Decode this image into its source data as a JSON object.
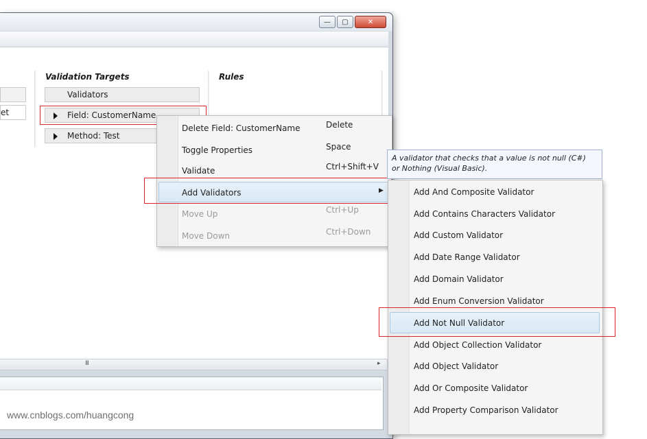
{
  "window": {
    "caption_buttons": {
      "minimize_glyph": "—",
      "maximize_glyph": "▢",
      "close_glyph": "✕"
    },
    "left_field_partial": "et",
    "scrollbar_grip": "III"
  },
  "columns": {
    "validation_targets_title": "Validation Targets",
    "rules_title": "Rules"
  },
  "targets": {
    "validators_label": "Validators",
    "field_label": "Field: CustomerName",
    "method_label": "Method: Test"
  },
  "context_menu": {
    "items": [
      {
        "label": "Delete Field: CustomerName",
        "shortcut": "Delete",
        "enabled": true
      },
      {
        "label": "Toggle Properties",
        "shortcut": "Space",
        "enabled": true
      },
      {
        "label": "Validate",
        "shortcut": "Ctrl+Shift+V",
        "enabled": true
      },
      {
        "label": "Add Validators",
        "shortcut": "",
        "enabled": true,
        "submenu_arrow": "▶"
      },
      {
        "label": "Move Up",
        "shortcut": "Ctrl+Up",
        "enabled": false
      },
      {
        "label": "Move Down",
        "shortcut": "Ctrl+Down",
        "enabled": false
      }
    ]
  },
  "tooltip": {
    "line1": "A validator that checks that a value is not null (C#)",
    "line2": "or Nothing (Visual Basic)."
  },
  "validators_submenu": {
    "items": [
      "Add And Composite Validator",
      "Add Contains Characters Validator",
      "Add Custom Validator",
      "Add Date Range Validator",
      "Add Domain Validator",
      "Add Enum Conversion Validator",
      "Add Not Null Validator",
      "Add Object Collection Validator",
      "Add Object Validator",
      "Add Or Composite Validator",
      "Add Property Comparison Validator"
    ],
    "highlighted": "Add Not Null Validator"
  },
  "watermark": "www.cnblogs.com/huangcong",
  "colors": {
    "annotation_red": "#d9242a",
    "highlight_blue": "#d9e9f5"
  }
}
